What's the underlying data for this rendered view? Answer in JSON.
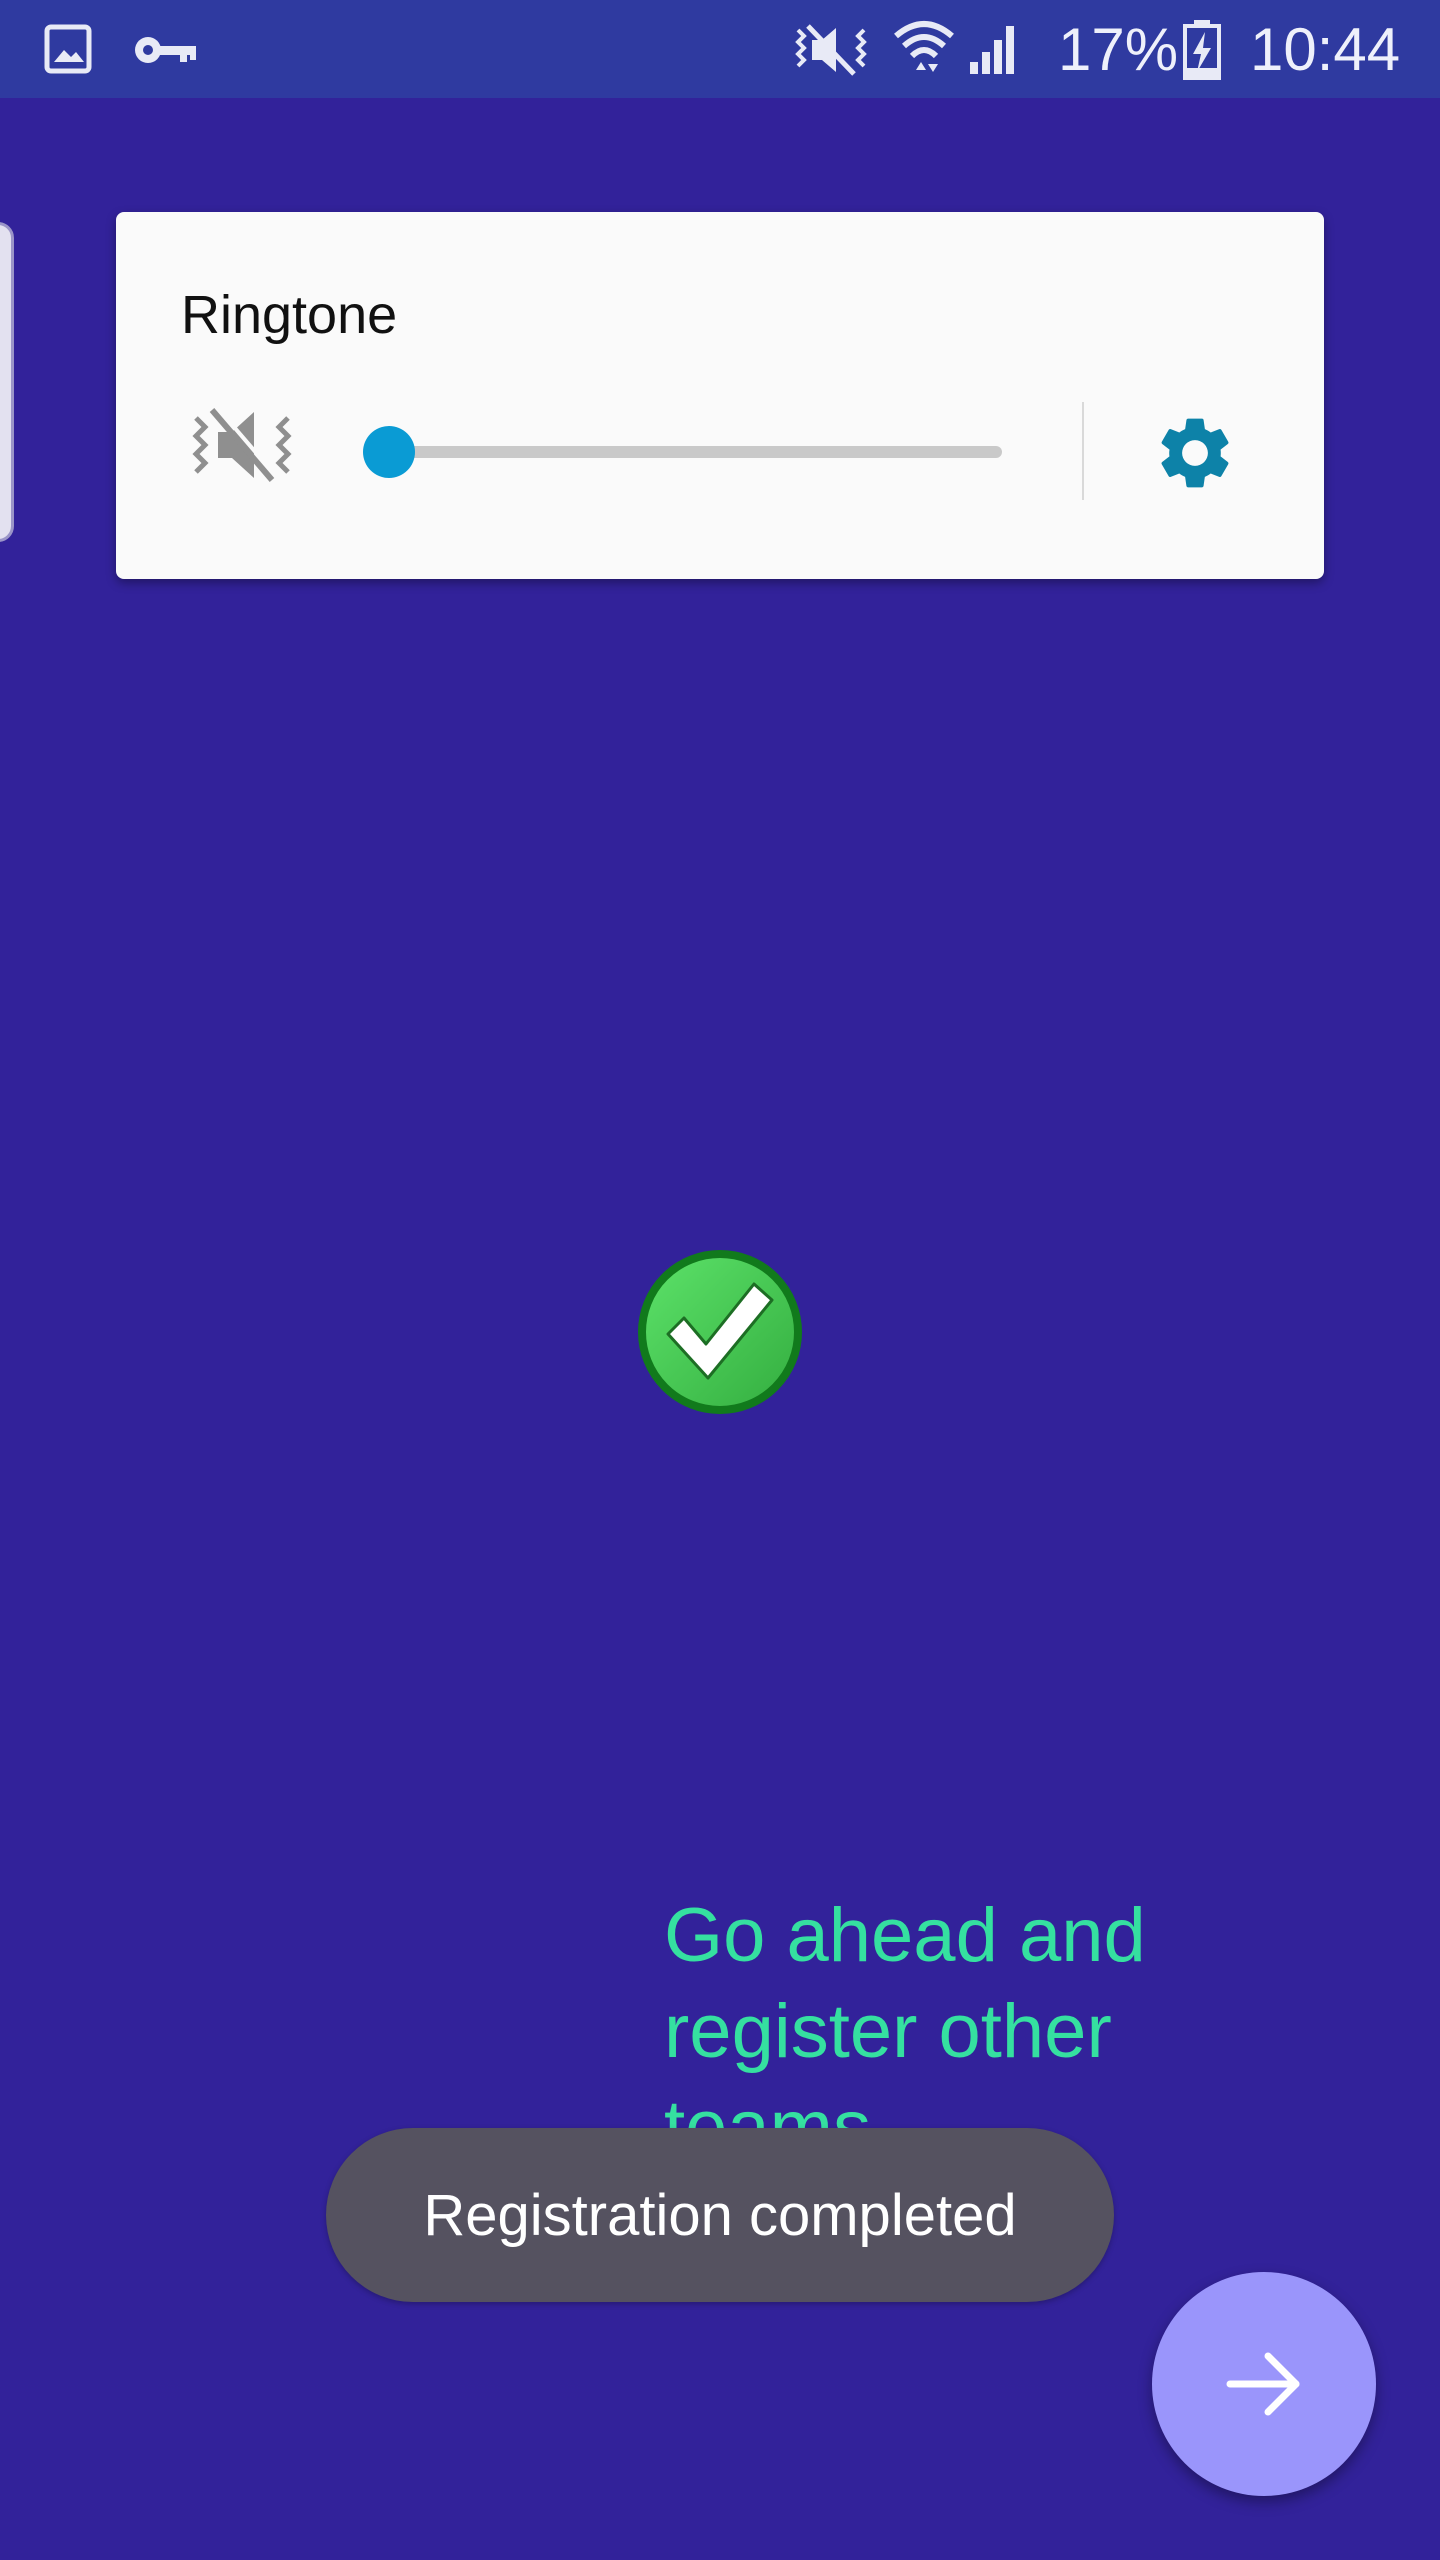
{
  "status_bar": {
    "battery_percent": "17%",
    "time": "10:44",
    "icons": [
      "gallery-icon",
      "vpn-key-icon",
      "vibrate-mute-icon",
      "wifi-icon",
      "signal-icon",
      "battery-charging-icon"
    ]
  },
  "volume_panel": {
    "title": "Ringtone",
    "level": 0,
    "mode_icon": "vibrate-mute-icon",
    "settings_icon": "gear-icon"
  },
  "content": {
    "status_icon": "success-check-icon",
    "message": "Go ahead and register other teams"
  },
  "toast": {
    "text": "Registration completed"
  },
  "fab": {
    "icon": "arrow-right-icon"
  },
  "colors": {
    "background": "#32229a",
    "status_bar": "#2f3aa0",
    "accent": "#0a9bd4",
    "message": "#35e0a0",
    "fab": "#9a95fb"
  }
}
